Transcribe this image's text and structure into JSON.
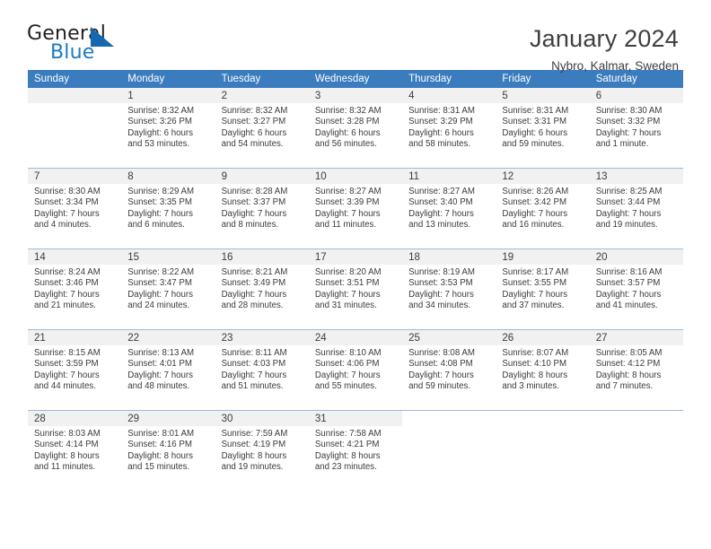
{
  "brand": {
    "name_part1": "General",
    "name_part2": "Blue",
    "flag_icon": "triangle-flag-icon",
    "accent_color": "#1668b0"
  },
  "header": {
    "title": "January 2024",
    "subtitle": "Nybro, Kalmar, Sweden"
  },
  "theme": {
    "header_row_bg": "#3a7cbe",
    "daynum_bg": "#f1f1f1",
    "grid_line": "#9bbcd8",
    "text": "#3b3b3b"
  },
  "calendar": {
    "weekday_headers": [
      "Sunday",
      "Monday",
      "Tuesday",
      "Wednesday",
      "Thursday",
      "Friday",
      "Saturday"
    ],
    "labels": {
      "sunrise": "Sunrise:",
      "sunset": "Sunset:",
      "daylight": "Daylight:"
    },
    "weeks": [
      [
        {
          "day": "",
          "sunrise": "",
          "sunset": "",
          "daylight_line1": "",
          "daylight_line2": ""
        },
        {
          "day": "1",
          "sunrise": "Sunrise: 8:32 AM",
          "sunset": "Sunset: 3:26 PM",
          "daylight_line1": "Daylight: 6 hours",
          "daylight_line2": "and 53 minutes."
        },
        {
          "day": "2",
          "sunrise": "Sunrise: 8:32 AM",
          "sunset": "Sunset: 3:27 PM",
          "daylight_line1": "Daylight: 6 hours",
          "daylight_line2": "and 54 minutes."
        },
        {
          "day": "3",
          "sunrise": "Sunrise: 8:32 AM",
          "sunset": "Sunset: 3:28 PM",
          "daylight_line1": "Daylight: 6 hours",
          "daylight_line2": "and 56 minutes."
        },
        {
          "day": "4",
          "sunrise": "Sunrise: 8:31 AM",
          "sunset": "Sunset: 3:29 PM",
          "daylight_line1": "Daylight: 6 hours",
          "daylight_line2": "and 58 minutes."
        },
        {
          "day": "5",
          "sunrise": "Sunrise: 8:31 AM",
          "sunset": "Sunset: 3:31 PM",
          "daylight_line1": "Daylight: 6 hours",
          "daylight_line2": "and 59 minutes."
        },
        {
          "day": "6",
          "sunrise": "Sunrise: 8:30 AM",
          "sunset": "Sunset: 3:32 PM",
          "daylight_line1": "Daylight: 7 hours",
          "daylight_line2": "and 1 minute."
        }
      ],
      [
        {
          "day": "7",
          "sunrise": "Sunrise: 8:30 AM",
          "sunset": "Sunset: 3:34 PM",
          "daylight_line1": "Daylight: 7 hours",
          "daylight_line2": "and 4 minutes."
        },
        {
          "day": "8",
          "sunrise": "Sunrise: 8:29 AM",
          "sunset": "Sunset: 3:35 PM",
          "daylight_line1": "Daylight: 7 hours",
          "daylight_line2": "and 6 minutes."
        },
        {
          "day": "9",
          "sunrise": "Sunrise: 8:28 AM",
          "sunset": "Sunset: 3:37 PM",
          "daylight_line1": "Daylight: 7 hours",
          "daylight_line2": "and 8 minutes."
        },
        {
          "day": "10",
          "sunrise": "Sunrise: 8:27 AM",
          "sunset": "Sunset: 3:39 PM",
          "daylight_line1": "Daylight: 7 hours",
          "daylight_line2": "and 11 minutes."
        },
        {
          "day": "11",
          "sunrise": "Sunrise: 8:27 AM",
          "sunset": "Sunset: 3:40 PM",
          "daylight_line1": "Daylight: 7 hours",
          "daylight_line2": "and 13 minutes."
        },
        {
          "day": "12",
          "sunrise": "Sunrise: 8:26 AM",
          "sunset": "Sunset: 3:42 PM",
          "daylight_line1": "Daylight: 7 hours",
          "daylight_line2": "and 16 minutes."
        },
        {
          "day": "13",
          "sunrise": "Sunrise: 8:25 AM",
          "sunset": "Sunset: 3:44 PM",
          "daylight_line1": "Daylight: 7 hours",
          "daylight_line2": "and 19 minutes."
        }
      ],
      [
        {
          "day": "14",
          "sunrise": "Sunrise: 8:24 AM",
          "sunset": "Sunset: 3:46 PM",
          "daylight_line1": "Daylight: 7 hours",
          "daylight_line2": "and 21 minutes."
        },
        {
          "day": "15",
          "sunrise": "Sunrise: 8:22 AM",
          "sunset": "Sunset: 3:47 PM",
          "daylight_line1": "Daylight: 7 hours",
          "daylight_line2": "and 24 minutes."
        },
        {
          "day": "16",
          "sunrise": "Sunrise: 8:21 AM",
          "sunset": "Sunset: 3:49 PM",
          "daylight_line1": "Daylight: 7 hours",
          "daylight_line2": "and 28 minutes."
        },
        {
          "day": "17",
          "sunrise": "Sunrise: 8:20 AM",
          "sunset": "Sunset: 3:51 PM",
          "daylight_line1": "Daylight: 7 hours",
          "daylight_line2": "and 31 minutes."
        },
        {
          "day": "18",
          "sunrise": "Sunrise: 8:19 AM",
          "sunset": "Sunset: 3:53 PM",
          "daylight_line1": "Daylight: 7 hours",
          "daylight_line2": "and 34 minutes."
        },
        {
          "day": "19",
          "sunrise": "Sunrise: 8:17 AM",
          "sunset": "Sunset: 3:55 PM",
          "daylight_line1": "Daylight: 7 hours",
          "daylight_line2": "and 37 minutes."
        },
        {
          "day": "20",
          "sunrise": "Sunrise: 8:16 AM",
          "sunset": "Sunset: 3:57 PM",
          "daylight_line1": "Daylight: 7 hours",
          "daylight_line2": "and 41 minutes."
        }
      ],
      [
        {
          "day": "21",
          "sunrise": "Sunrise: 8:15 AM",
          "sunset": "Sunset: 3:59 PM",
          "daylight_line1": "Daylight: 7 hours",
          "daylight_line2": "and 44 minutes."
        },
        {
          "day": "22",
          "sunrise": "Sunrise: 8:13 AM",
          "sunset": "Sunset: 4:01 PM",
          "daylight_line1": "Daylight: 7 hours",
          "daylight_line2": "and 48 minutes."
        },
        {
          "day": "23",
          "sunrise": "Sunrise: 8:11 AM",
          "sunset": "Sunset: 4:03 PM",
          "daylight_line1": "Daylight: 7 hours",
          "daylight_line2": "and 51 minutes."
        },
        {
          "day": "24",
          "sunrise": "Sunrise: 8:10 AM",
          "sunset": "Sunset: 4:06 PM",
          "daylight_line1": "Daylight: 7 hours",
          "daylight_line2": "and 55 minutes."
        },
        {
          "day": "25",
          "sunrise": "Sunrise: 8:08 AM",
          "sunset": "Sunset: 4:08 PM",
          "daylight_line1": "Daylight: 7 hours",
          "daylight_line2": "and 59 minutes."
        },
        {
          "day": "26",
          "sunrise": "Sunrise: 8:07 AM",
          "sunset": "Sunset: 4:10 PM",
          "daylight_line1": "Daylight: 8 hours",
          "daylight_line2": "and 3 minutes."
        },
        {
          "day": "27",
          "sunrise": "Sunrise: 8:05 AM",
          "sunset": "Sunset: 4:12 PM",
          "daylight_line1": "Daylight: 8 hours",
          "daylight_line2": "and 7 minutes."
        }
      ],
      [
        {
          "day": "28",
          "sunrise": "Sunrise: 8:03 AM",
          "sunset": "Sunset: 4:14 PM",
          "daylight_line1": "Daylight: 8 hours",
          "daylight_line2": "and 11 minutes."
        },
        {
          "day": "29",
          "sunrise": "Sunrise: 8:01 AM",
          "sunset": "Sunset: 4:16 PM",
          "daylight_line1": "Daylight: 8 hours",
          "daylight_line2": "and 15 minutes."
        },
        {
          "day": "30",
          "sunrise": "Sunrise: 7:59 AM",
          "sunset": "Sunset: 4:19 PM",
          "daylight_line1": "Daylight: 8 hours",
          "daylight_line2": "and 19 minutes."
        },
        {
          "day": "31",
          "sunrise": "Sunrise: 7:58 AM",
          "sunset": "Sunset: 4:21 PM",
          "daylight_line1": "Daylight: 8 hours",
          "daylight_line2": "and 23 minutes."
        },
        {
          "day": "",
          "sunrise": "",
          "sunset": "",
          "daylight_line1": "",
          "daylight_line2": ""
        },
        {
          "day": "",
          "sunrise": "",
          "sunset": "",
          "daylight_line1": "",
          "daylight_line2": ""
        },
        {
          "day": "",
          "sunrise": "",
          "sunset": "",
          "daylight_line1": "",
          "daylight_line2": ""
        }
      ]
    ]
  }
}
